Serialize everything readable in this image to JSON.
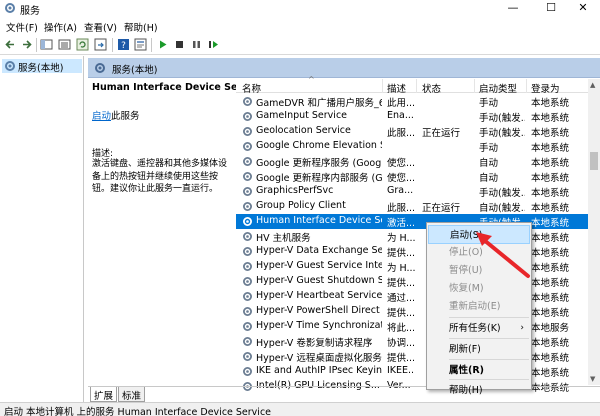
{
  "window": {
    "title": "服务",
    "minimize": "—",
    "maximize": "☐",
    "close": "✕"
  },
  "menu": [
    "文件(F)",
    "操作(A)",
    "查看(V)",
    "帮助(H)"
  ],
  "toolbar_icons": [
    "back-icon",
    "forward-icon",
    "show-tree-icon",
    "list-icon",
    "refresh-icon",
    "export-icon",
    "help-icon",
    "properties-icon",
    "play-icon",
    "stop-icon",
    "pause-icon",
    "restart-icon"
  ],
  "tree": {
    "label": "服务(本地)"
  },
  "pane": {
    "header": "服务(本地)"
  },
  "description": {
    "service_name": "Human Interface Device Service",
    "link": "启动",
    "link_suffix": "此服务",
    "label": "描述:",
    "text": "激活键盘、遥控器和其他多媒体设备上的热按钮并继续使用这些按钮。建议你让此服务一直运行。"
  },
  "columns": [
    "名称",
    "描述",
    "状态",
    "启动类型",
    "登录为"
  ],
  "rows": [
    {
      "name": "GameDVR 和广播用户服务_6d...",
      "desc": "此用...",
      "status": "",
      "startup": "手动",
      "logon": "本地系统"
    },
    {
      "name": "GameInput Service",
      "desc": "Ena...",
      "status": "",
      "startup": "手动(触发...",
      "logon": "本地系统"
    },
    {
      "name": "Geolocation Service",
      "desc": "此服...",
      "status": "正在运行",
      "startup": "手动(触发...",
      "logon": "本地系统"
    },
    {
      "name": "Google Chrome Elevation Se...",
      "desc": "",
      "status": "",
      "startup": "手动",
      "logon": "本地系统"
    },
    {
      "name": "Google 更新程序服务 (Google...",
      "desc": "使您...",
      "status": "",
      "startup": "自动",
      "logon": "本地系统"
    },
    {
      "name": "Google 更新程序内部服务 (Go...",
      "desc": "使您...",
      "status": "",
      "startup": "自动",
      "logon": "本地系统"
    },
    {
      "name": "GraphicsPerfSvc",
      "desc": "Gra...",
      "status": "",
      "startup": "手动(触发...",
      "logon": "本地系统"
    },
    {
      "name": "Group Policy Client",
      "desc": "此服...",
      "status": "正在运行",
      "startup": "自动(触发...",
      "logon": "本地系统"
    },
    {
      "name": "Human Interface Device Servi...",
      "desc": "激活...",
      "status": "",
      "startup": "手动(触发...",
      "logon": "本地系统",
      "selected": true
    },
    {
      "name": "HV 主机服务",
      "desc": "为 H...",
      "status": "",
      "startup": "",
      "logon": "本地系统"
    },
    {
      "name": "Hyper-V Data Exchange Service",
      "desc": "提供...",
      "status": "",
      "startup": "",
      "logon": "本地系统"
    },
    {
      "name": "Hyper-V Guest Service Interf...",
      "desc": "为 H...",
      "status": "",
      "startup": "",
      "logon": "本地系统"
    },
    {
      "name": "Hyper-V Guest Shutdown Ser...",
      "desc": "提供...",
      "status": "",
      "startup": "",
      "logon": "本地系统"
    },
    {
      "name": "Hyper-V Heartbeat Service",
      "desc": "通过...",
      "status": "",
      "startup": "",
      "logon": "本地系统"
    },
    {
      "name": "Hyper-V PowerShell Direct S...",
      "desc": "提供...",
      "status": "",
      "startup": "",
      "logon": "本地系统"
    },
    {
      "name": "Hyper-V Time Synchronizatio...",
      "desc": "将此...",
      "status": "",
      "startup": "",
      "logon": "本地服务"
    },
    {
      "name": "Hyper-V 卷影复制请求程序",
      "desc": "协调...",
      "status": "",
      "startup": "",
      "logon": "本地系统"
    },
    {
      "name": "Hyper-V 远程桌面虚拟化服务",
      "desc": "提供...",
      "status": "",
      "startup": "",
      "logon": "本地系统"
    },
    {
      "name": "IKE and AuthIP IPsec Keying ...",
      "desc": "IKEE...",
      "status": "",
      "startup": "",
      "logon": "本地系统"
    },
    {
      "name": "Intel(R) GPU Licensing S...",
      "desc": "Ver...",
      "status": "",
      "startup": "",
      "logon": "本地系统"
    }
  ],
  "context_menu": [
    {
      "label": "启动(S)",
      "state": "highlight"
    },
    {
      "label": "停止(O)",
      "state": "disabled"
    },
    {
      "label": "暂停(U)",
      "state": "disabled"
    },
    {
      "label": "恢复(M)",
      "state": "disabled"
    },
    {
      "label": "重新启动(E)",
      "state": "disabled"
    },
    {
      "label": "所有任务(K)",
      "state": "normal",
      "submenu": "›"
    },
    {
      "label": "刷新(F)",
      "state": "normal"
    },
    {
      "label": "属性(R)",
      "state": "bold"
    },
    {
      "label": "帮助(H)",
      "state": "normal"
    }
  ],
  "tabs": [
    "扩展",
    "标准"
  ],
  "status_text": "启动 本地计算机 上的服务 Human Interface Device Service",
  "colors": {
    "selection": "#0078d7",
    "header_band": "#b9cee8",
    "highlight": "#cce8ff",
    "arrow": "#e8262a",
    "link": "#0066cc"
  }
}
